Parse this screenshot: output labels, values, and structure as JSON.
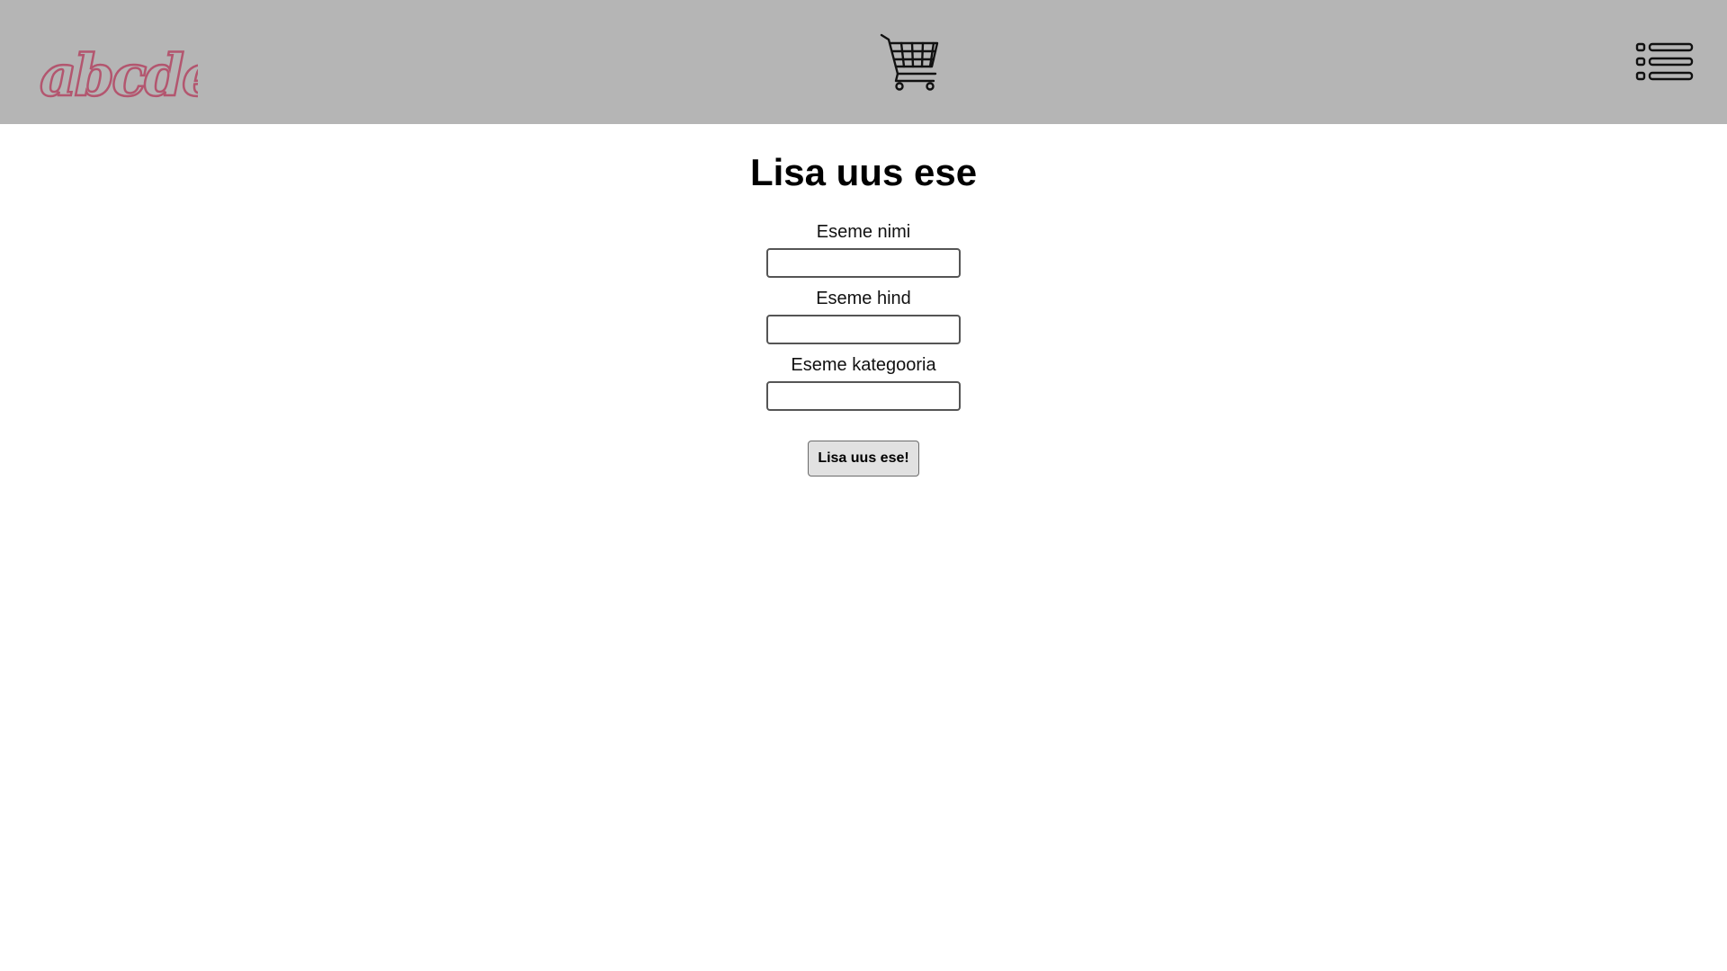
{
  "header": {
    "logo_text": "abcdef",
    "cart_icon": "shopping-cart-icon",
    "menu_icon": "list-menu-icon",
    "background": "#b5b5b5",
    "logo_color": "#b3566f"
  },
  "main": {
    "title": "Lisa uus ese",
    "fields": [
      {
        "label": "Eseme nimi",
        "value": ""
      },
      {
        "label": "Eseme hind",
        "value": ""
      },
      {
        "label": "Eseme kategooria",
        "value": ""
      }
    ],
    "submit_label": "Lisa uus ese!"
  }
}
